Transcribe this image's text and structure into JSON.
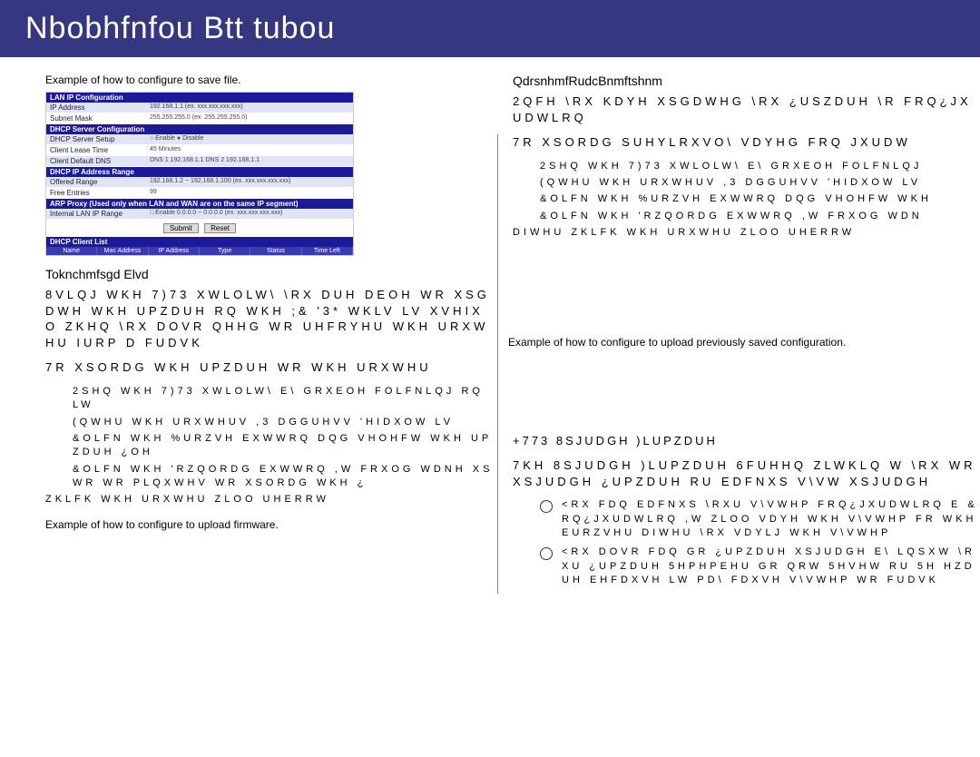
{
  "title": "Nbobhfnfou   Btt  tubou",
  "left": {
    "caption1": "Example of how to configure to save file.",
    "caption2": "Example of how to configure to upload firmware.",
    "config": {
      "sec1": "LAN IP Configuration",
      "ip_lab": "IP Address",
      "ip_val": "192.168.1.1      (ex. xxx.xxx.xxx.xxx)",
      "mask_lab": "Subnet Mask",
      "mask_val": "255.255.255.0   (ex. 255.255.255.0)",
      "sec2": "DHCP Server Configuration",
      "dhcp_lab": "DHCP Server Setup",
      "dhcp_val": "○ Enable  ● Disable",
      "lease_lab": "Client Lease Time",
      "lease_val": "45   Minutes",
      "dns_lab": "Client Default DNS",
      "dns_val": "DNS 1 192.168.1.1   DNS 2 192.168.1.1",
      "sec3": "DHCP IP Address Range",
      "range_lab": "Offered Range",
      "range_val": "192.168.1.2   ~ 192.168.1.100   (ex. xxx.xxx.xxx.xxx)",
      "free_lab": "Free Entries",
      "free_val": "99",
      "sec4": "ARP Proxy (Used only when LAN and WAN are on the same IP segment)",
      "arp_lab": "Internal LAN IP Range",
      "arp_val": "□ Enable 0.0.0.0    ~ 0.0.0.0     (ex. xxx.xxx.xxx.xxx)",
      "btn1": "Submit",
      "btn2": "Reset",
      "sec5": "DHCP Client List",
      "h1": "Name",
      "h2": "Mac Address",
      "h3": "IP Address",
      "h4": "Type",
      "h5": "Status",
      "h6": "Time Left"
    },
    "h2a": "Toknchmfsgd Elvd",
    "p1": "8VLQJ WKH 7)73 XWLOLW\\ \\RX DUH DEOH WR XSGDWH WKH UPZDUH RQ WKH ;& '3* WKLV LV XVHIXO ZKHQ \\RX DOVR QHHG WR UHFRYHU WKH URXWHU IURP D FUDVK",
    "p2": "7R XSORDG WKH  UPZDUH WR WKH URXWHU",
    "s1": "2SHQ WKH 7)73 XWLOLW\\ E\\ GRXEOH FOLFNLQJ RQ LW",
    "s2": "(QWHU WKH URXWHUV ,3 DGGUHVV 'HIDXOW LV",
    "s3": "&OLFN WKH %URZVH EXWWRQ DQG VHOHFW WKH  UPZDUH ¿OH",
    "s4": "&OLFN WKH 'RZQORDG EXWWRQ ,W FRXOG WDNH XS WR  WR  PLQXWHV WR XSORDG WKH ¿",
    "s5": "ZKLFK WKH URXWHU ZLOO UHERRW"
  },
  "right": {
    "h2a": "QdrsnhmfRudcBnmftshnm",
    "p1": "2QFH \\RX KDYH XSGDWHG \\RX ¿USZDUH \\R FRQ¿JXUDWLRQ",
    "p2": "7R XSORDG SUHYLRXVO\\ VDYHG FRQ JXUDW",
    "s1": "2SHQ WKH 7)73 XWLOLW\\ E\\ GRXEOH FOLFNLQJ",
    "s2": "(QWHU WKH URXWHUV ,3 DGGUHVV 'HIDXOW LV",
    "s3": "&OLFN WKH %URZVH EXWWRQ DQG VHOHFW WKH",
    "s4": "&OLFN WKH 'RZQORDG EXWWRQ ,W FRXOG WDN",
    "s5": "DIWHU ZKLFK WKH URXWHU ZLOO UHERRW",
    "caption": "Example of how to configure to upload previously saved configuration.",
    "h2b": "+773 8SJUDGH )LUPZDUH",
    "p3": "7KH 8SJUDGH )LUPZDUH 6FUHHQ ZLWKLQ W \\RX WR XSJUDGH ¿UPZDUH RU EDFNXS V\\VW XSJUDGH",
    "b1": "<RX FDQ EDFNXS \\RXU V\\VWHP FRQ¿JXUDWLRQ E &RQ¿JXUDWLRQ ,W ZLOO VDYH WKH V\\VWHP FR WKH EURZVHU DIWHU \\RX VDYLJ WKH V\\VWHP",
    "b2": "<RX DOVR FDQ GR ¿UPZDUH XSJUDGH E\\ LQSXW \\RXU ¿UPZDUH 5HPHPEHU GR QRW 5HVHW RU 5H HZDUH EHFDXVH LW PD\\ FDXVH V\\VWHP WR FUDVK"
  }
}
